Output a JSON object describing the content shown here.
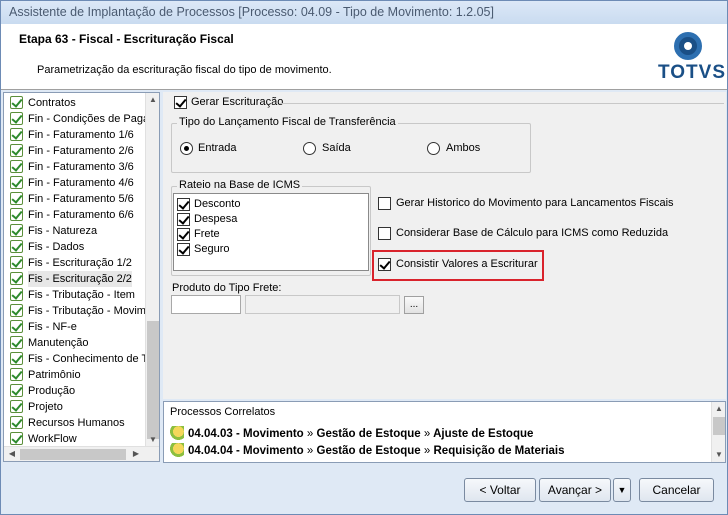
{
  "window": {
    "title": "Assistente de Implantação de Processos [Processo: 04.09 - Tipo de Movimento: 1.2.05]"
  },
  "header": {
    "step_title": "Etapa 63 - Fiscal - Escrituração Fiscal",
    "step_description": "Parametrização da escrituração fiscal do tipo de movimento.",
    "logo_text": "TOTVS"
  },
  "tree": {
    "items": [
      {
        "label": "Contratos"
      },
      {
        "label": "Fin - Condições de Pagamento"
      },
      {
        "label": "Fin - Faturamento 1/6"
      },
      {
        "label": "Fin - Faturamento 2/6"
      },
      {
        "label": "Fin - Faturamento 3/6"
      },
      {
        "label": "Fin - Faturamento 4/6"
      },
      {
        "label": "Fin - Faturamento 5/6"
      },
      {
        "label": "Fin - Faturamento 6/6"
      },
      {
        "label": "Fis - Natureza"
      },
      {
        "label": "Fis - Dados"
      },
      {
        "label": "Fis - Escrituração 1/2"
      },
      {
        "label": "Fis - Escrituração 2/2"
      },
      {
        "label": "Fis - Tributação - Item"
      },
      {
        "label": "Fis - Tributação - Movimento"
      },
      {
        "label": "Fis - NF-e"
      },
      {
        "label": "Manutenção"
      },
      {
        "label": "Fis - Conhecimento de Transporte"
      },
      {
        "label": "Patrimônio"
      },
      {
        "label": "Produção"
      },
      {
        "label": "Projeto"
      },
      {
        "label": "Recursos Humanos"
      },
      {
        "label": "WorkFlow"
      }
    ]
  },
  "form": {
    "gerar_escrituracao": "Gerar Escrituração",
    "tipo_lancamento": {
      "label": "Tipo do Lançamento Fiscal de Transferência",
      "options": [
        "Entrada",
        "Saída",
        "Ambos"
      ],
      "selected": "Entrada"
    },
    "rateio": {
      "label": "Rateio na Base de ICMS",
      "items": [
        "Desconto",
        "Despesa",
        "Frete",
        "Seguro"
      ]
    },
    "gerar_historico": "Gerar Historico do Movimento para Lancamentos Fiscais",
    "considerar_base": "Considerar Base de Cálculo para ICMS como Reduzida",
    "consistir_valores": "Consistir Valores a Escriturar",
    "produto_frete": {
      "label": "Produto do Tipo Frete:",
      "code": "",
      "description": "",
      "lookup_button": "..."
    }
  },
  "related": {
    "header": "Processos Correlatos",
    "rows": [
      {
        "code": "04.04.03",
        "path1": "Movimento",
        "path2": "Gestão de Estoque",
        "path3": "Ajuste de Estoque"
      },
      {
        "code": "04.04.04",
        "path1": "Movimento",
        "path2": "Gestão de Estoque",
        "path3": "Requisição de Materiais"
      }
    ],
    "separator": "»"
  },
  "footer": {
    "back": "< Voltar",
    "next": "Avançar >",
    "next_menu": "▼",
    "cancel": "Cancelar"
  }
}
